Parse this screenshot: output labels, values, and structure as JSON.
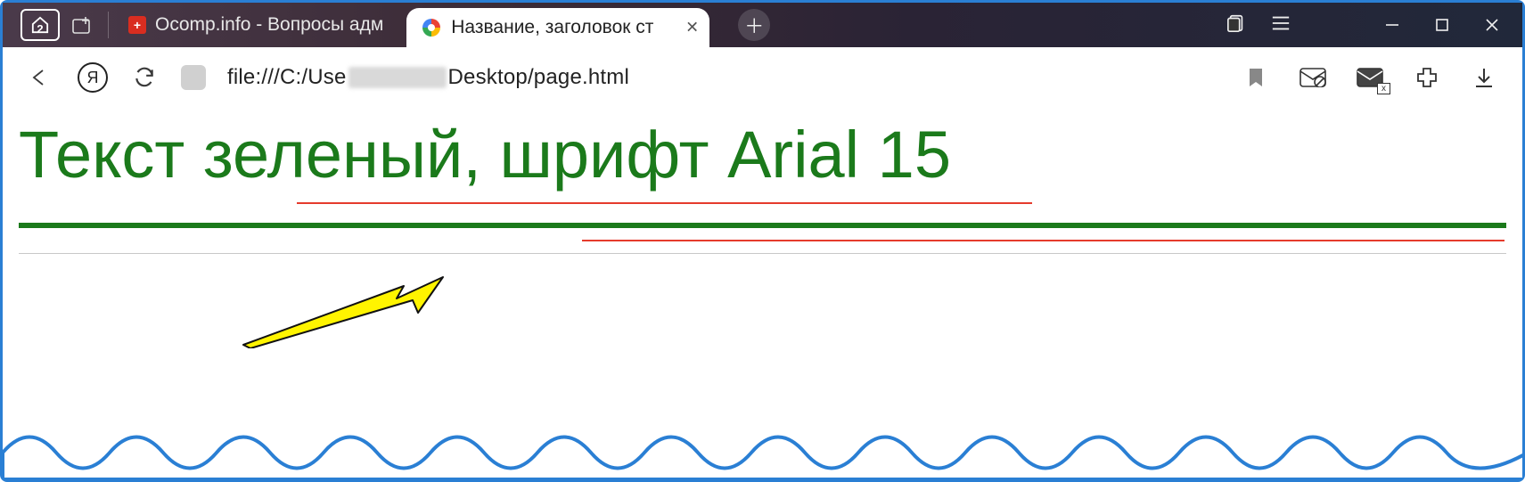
{
  "titlebar": {
    "home_badge": "2",
    "background_tab": {
      "favicon_glyph": "+",
      "label": "Ocomp.info - Вопросы адм"
    },
    "active_tab": {
      "label": "Название, заголовок ст"
    }
  },
  "addressbar": {
    "yandex_glyph": "Я",
    "url_prefix": "file:///C:/Use",
    "url_suffix": "Desktop/page.html",
    "env_x_label": "x"
  },
  "page": {
    "headline": "Текст зеленый, шрифт Arial 15"
  }
}
